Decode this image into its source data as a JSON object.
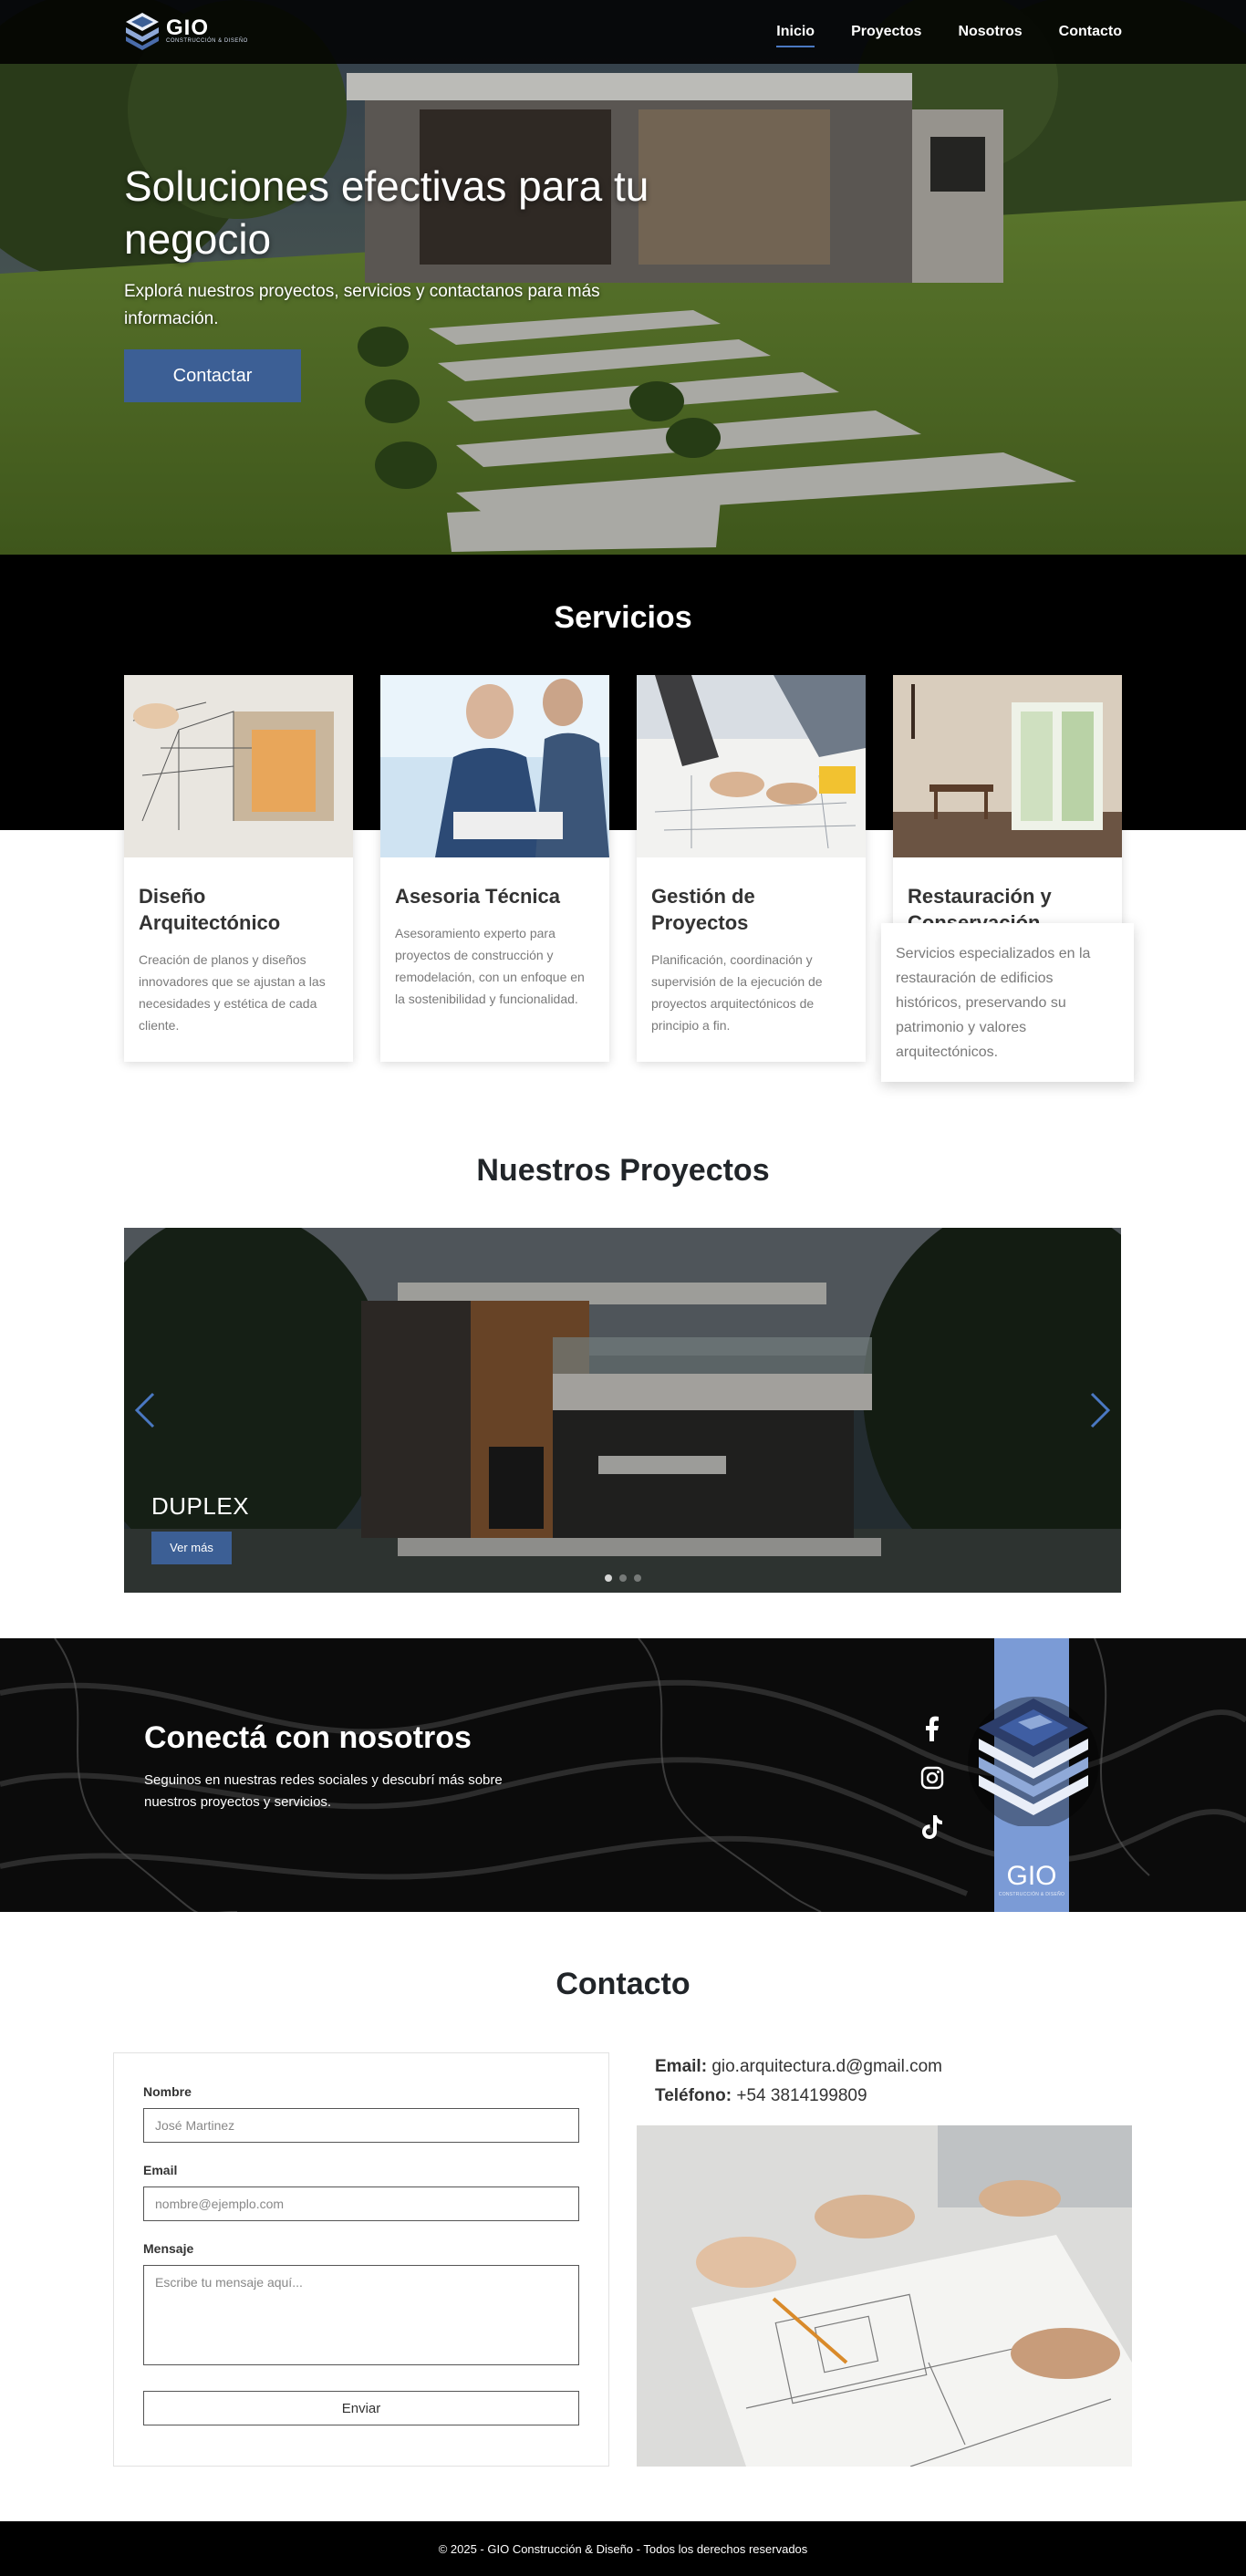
{
  "nav": {
    "logo_text": "GIO",
    "logo_sub": "CONSTRUCCIÓN & DISEÑO",
    "links": [
      {
        "label": "Inicio",
        "active": true
      },
      {
        "label": "Proyectos",
        "active": false
      },
      {
        "label": "Nosotros",
        "active": false
      },
      {
        "label": "Contacto",
        "active": false
      }
    ]
  },
  "hero": {
    "title": "Soluciones efectivas para tu negocio",
    "subtitle": "Explorá nuestros proyectos, servicios y contactanos para más información.",
    "cta_label": "Contactar"
  },
  "services": {
    "title": "Servicios",
    "items": [
      {
        "name": "Diseño Arquitectónico",
        "description": "Creación de planos y diseños innovadores que se ajustan a las necesidades y estética de cada cliente."
      },
      {
        "name": "Asesoria Técnica",
        "description": "Asesoramiento experto para proyectos de construcción y remodelación, con un enfoque en la sostenibilidad y funcionalidad."
      },
      {
        "name": "Gestión de Proyectos",
        "description": "Planificación, coordinación y supervisión de la ejecución de proyectos arquitectónicos de principio a fin."
      },
      {
        "name": "Restauración y Conservación",
        "description": "Servicios especializados en la restauración de edificios históricos, preservando su patrimonio y valores arquitectónicos."
      }
    ]
  },
  "projects": {
    "title": "Nuestros Proyectos",
    "slide_title": "DUPLEX",
    "slide_button": "Ver más",
    "slide_count": 3,
    "active_slide": 0
  },
  "social": {
    "title": "Conectá con nosotros",
    "subtitle": "Seguinos en nuestras redes sociales y descubrí más sobre nuestros proyectos y servicios.",
    "icons": [
      "facebook-icon",
      "instagram-icon",
      "tiktok-icon"
    ],
    "logo_text": "GIO",
    "logo_sub": "CONSTRUCCIÓN & DISEÑO"
  },
  "contact": {
    "title": "Contacto",
    "form": {
      "name_label": "Nombre",
      "name_placeholder": "José Martinez",
      "email_label": "Email",
      "email_placeholder": "nombre@ejemplo.com",
      "message_label": "Mensaje",
      "message_placeholder": "Escribe tu mensaje aquí...",
      "submit_label": "Enviar"
    },
    "email_label": "Email:",
    "email_value": "gio.arquitectura.d@gmail.com",
    "phone_label": "Teléfono:",
    "phone_value": "+54 3814199809"
  },
  "footer": {
    "text": "© 2025 - GIO Construcción & Diseño - Todos los derechos reservados"
  },
  "colors": {
    "accent": "#3c5f95",
    "nav_underline": "#4a78c2",
    "logo_banner": "#7b9bd6",
    "dark": "#000000"
  }
}
